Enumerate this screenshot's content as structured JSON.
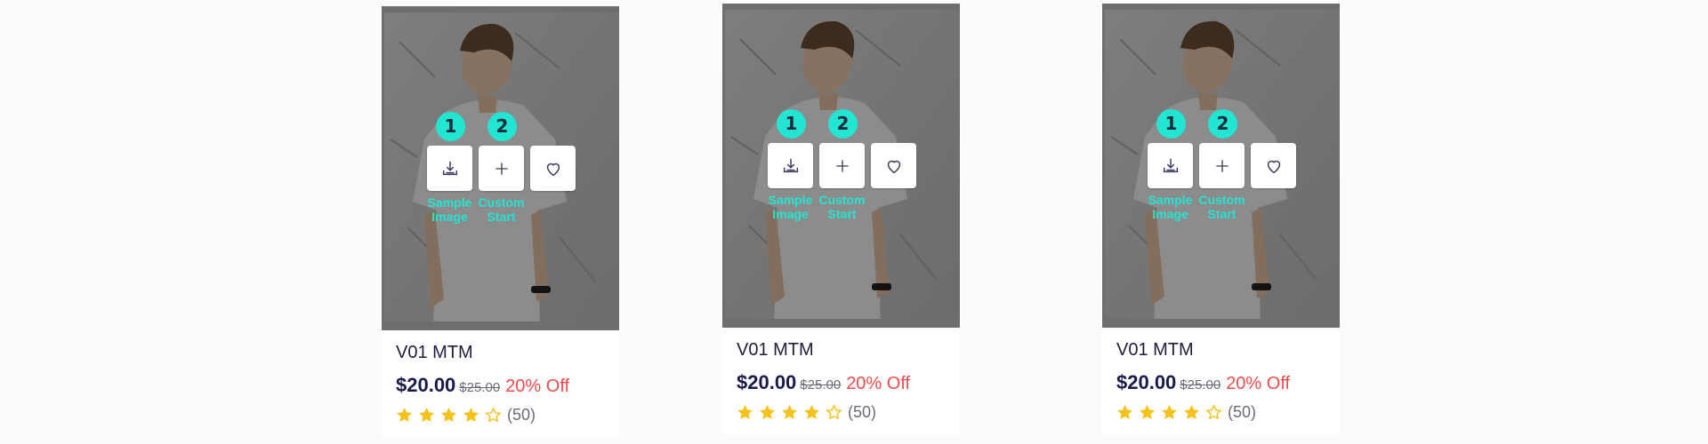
{
  "colors": {
    "accent_teal": "#22e5d2",
    "price_navy": "#1a1a4b",
    "discount_red": "#ef4b4b",
    "star_gold": "#f6c21a"
  },
  "products": [
    {
      "name": "V01 MTM",
      "price": "$20.00",
      "old_price": "$25.00",
      "discount": "20% Off",
      "rating_stars": 4,
      "rating_max": 5,
      "reviews": "(50)",
      "actions": [
        {
          "step": "1",
          "icon": "download-icon",
          "caption": "Sample\nImage"
        },
        {
          "step": "2",
          "icon": "plus-icon",
          "caption": "Custom\nStart"
        },
        {
          "icon": "heart-icon"
        }
      ]
    },
    {
      "name": "V01 MTM",
      "price": "$20.00",
      "old_price": "$25.00",
      "discount": "20% Off",
      "rating_stars": 4,
      "rating_max": 5,
      "reviews": "(50)",
      "actions": [
        {
          "step": "1",
          "icon": "download-icon",
          "caption": "Sample\nImage"
        },
        {
          "step": "2",
          "icon": "plus-icon",
          "caption": "Custom\nStart"
        },
        {
          "icon": "heart-icon"
        }
      ]
    },
    {
      "name": "V01 MTM",
      "price": "$20.00",
      "old_price": "$25.00",
      "discount": "20% Off",
      "rating_stars": 4,
      "rating_max": 5,
      "reviews": "(50)",
      "actions": [
        {
          "step": "1",
          "icon": "download-icon",
          "caption": "Sample\nImage"
        },
        {
          "step": "2",
          "icon": "plus-icon",
          "caption": "Custom\nStart"
        },
        {
          "icon": "heart-icon"
        }
      ]
    }
  ]
}
